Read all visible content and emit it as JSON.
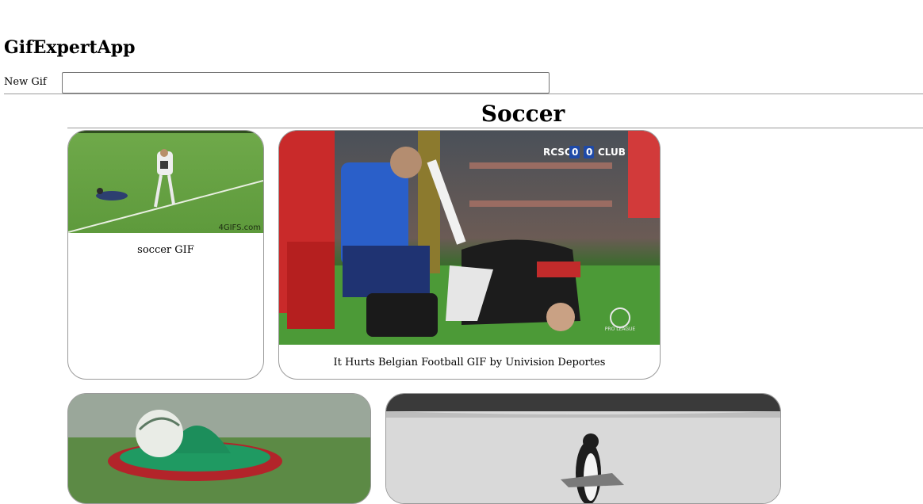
{
  "app": {
    "title": "GifExpertApp"
  },
  "form": {
    "label": "New Gif",
    "value": "",
    "placeholder": ""
  },
  "category": {
    "title": "Soccer"
  },
  "cards": [
    {
      "title": "soccer GIF",
      "watermark": "4GIFS.com"
    },
    {
      "title": "It Hurts Belgian Football GIF by Univision Deportes",
      "score_left": "RCSC",
      "score_a": "0",
      "score_b": "0",
      "score_right": "CLUB",
      "corner_logo": "PRO LEAGUE"
    },
    {
      "title": ""
    },
    {
      "title": ""
    }
  ]
}
